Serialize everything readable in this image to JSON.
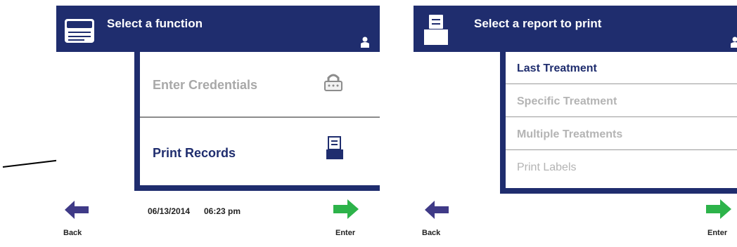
{
  "left_screen": {
    "title": "Select a function",
    "options": [
      {
        "label": "Enter Credentials",
        "icon": "padlock-icon",
        "state": "disabled"
      },
      {
        "label": "Print Records",
        "icon": "printer-icon",
        "state": "enabled"
      }
    ],
    "footer": {
      "date": "06/13/2014",
      "time": "06:23 pm",
      "back_label": "Back",
      "enter_label": "Enter"
    }
  },
  "right_screen": {
    "title": "Select a report to print",
    "options": [
      {
        "label": "Last Treatment",
        "state": "enabled"
      },
      {
        "label": "Specific Treatment",
        "state": "disabled"
      },
      {
        "label": "Multiple Treatments",
        "state": "disabled"
      },
      {
        "label": "Print Labels",
        "state": "disabled"
      }
    ],
    "footer": {
      "back_label": "Back",
      "enter_label": "Enter"
    }
  },
  "colors": {
    "header_bg": "#1f2d6e",
    "back_arrow": "#3f3a87",
    "enter_arrow": "#2db34a",
    "disabled_text": "#a8a8a8",
    "enabled_text": "#1f2d6e"
  }
}
